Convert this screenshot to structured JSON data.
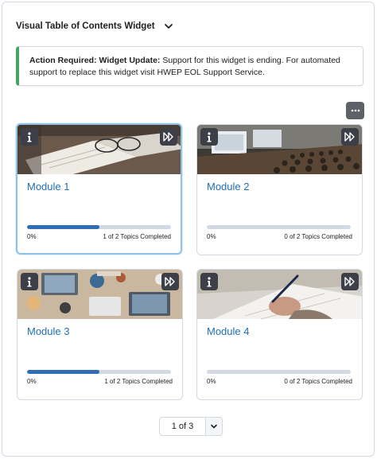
{
  "widget": {
    "title": "Visual Table of Contents Widget"
  },
  "alert": {
    "bold_text": "Action Required: Widget Update:",
    "body_text": "Support for this widget is ending. For automated support to replace this widget visit HWEP EOL Support Service."
  },
  "colors": {
    "link": "#1f6fb8",
    "progress_fill": "#2f6db5",
    "alert_accent": "#46a661"
  },
  "modules": [
    {
      "title": "Module 1",
      "percent_label": "0%",
      "topics_label": "1 of 2 Topics Completed",
      "progress_fraction": 0.5,
      "image": "desk-with-glasses-and-notebook"
    },
    {
      "title": "Module 2",
      "percent_label": "0%",
      "topics_label": "0 of 2 Topics Completed",
      "progress_fraction": 0.0,
      "image": "lecture-hall"
    },
    {
      "title": "Module 3",
      "percent_label": "0%",
      "topics_label": "1 of 2 Topics Completed",
      "progress_fraction": 0.5,
      "image": "team-table-with-laptops"
    },
    {
      "title": "Module 4",
      "percent_label": "0%",
      "topics_label": "0 of 2 Topics Completed",
      "progress_fraction": 0.0,
      "image": "hand-writing-with-pen"
    }
  ],
  "icons": {
    "header_toggle": "chevron-down-icon",
    "more": "ellipsis-icon",
    "info": "info-icon",
    "skip": "fast-forward-icon"
  },
  "pager": {
    "label": "1 of 3"
  }
}
